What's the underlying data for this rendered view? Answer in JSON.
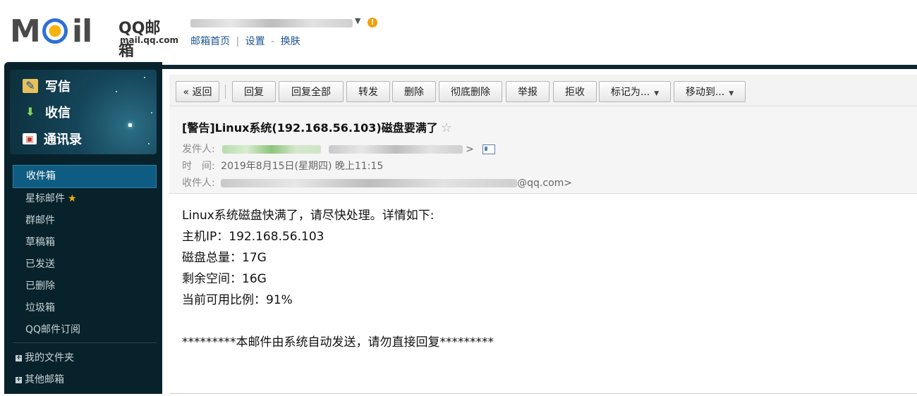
{
  "logo": {
    "letters": "MOil",
    "brand": "QQ邮箱",
    "domain": "mail.qq.com"
  },
  "top_links": {
    "home": "邮箱首页",
    "settings": "设置",
    "skin": "换肤",
    "sep1": "|",
    "sep2": "-"
  },
  "sidebar": {
    "compose": "写信",
    "inbox_check": "收信",
    "contacts": "通讯录",
    "folders": [
      "收件箱",
      "星标邮件",
      "群邮件",
      "草稿箱",
      "已发送",
      "已删除",
      "垃圾箱",
      "QQ邮件订阅"
    ],
    "starred_mark": "★",
    "my_folders": "我的文件夹",
    "other_mailboxes": "其他邮箱"
  },
  "toolbar": {
    "back": "« 返回",
    "reply": "回复",
    "reply_all": "回复全部",
    "forward": "转发",
    "delete": "删除",
    "delete_forever": "彻底删除",
    "report": "举报",
    "reject": "拒收",
    "mark_as": "标记为...",
    "move_to": "移动到..."
  },
  "mail": {
    "subject": "[警告]Linux系统(192.168.56.103)磁盘要满了",
    "from_label": "发件人:",
    "time_label": "时　间:",
    "time_value": "2019年8月15日(星期四) 晚上11:15",
    "to_label": "收件人:",
    "to_suffix": "@qq.com>",
    "body": [
      "Linux系统磁盘快满了，请尽快处理。详情如下:",
      "主机IP：192.168.56.103",
      "磁盘总量：17G",
      "剩余空间：16G",
      "当前可用比例：91%",
      "",
      "*********本邮件由系统自动发送，请勿直接回复*********"
    ]
  },
  "icons": {
    "favorite": "star-outline-icon",
    "account_dropdown": "chevron-down-icon",
    "account_warning": "warning-icon"
  },
  "colors": {
    "sidebar_bg": "#08222b",
    "active_folder": "#0f5c82",
    "link": "#1e5494",
    "warning": "#f0a10c"
  }
}
